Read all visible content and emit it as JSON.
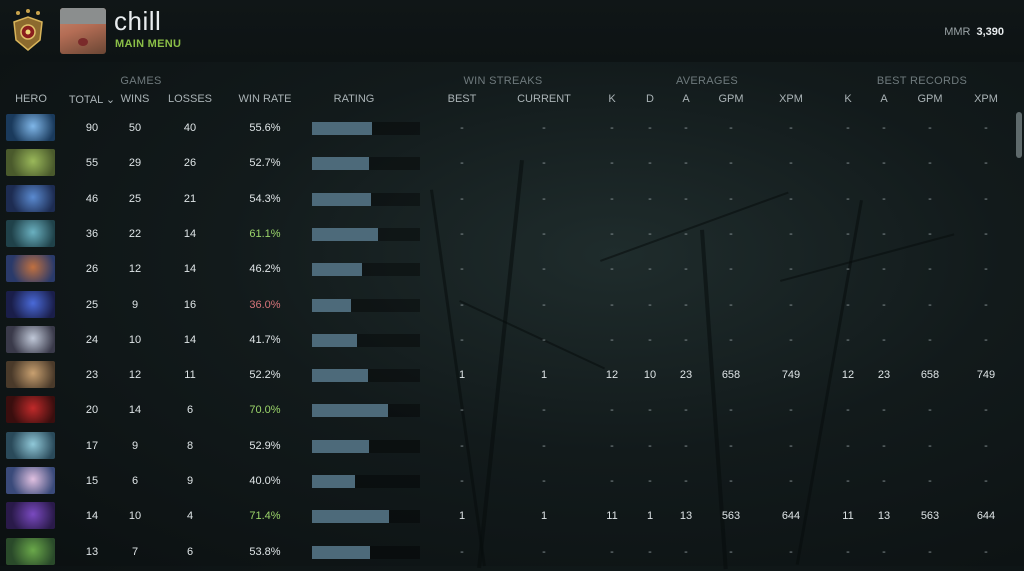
{
  "profile": {
    "name": "chill",
    "subtitle": "MAIN MENU",
    "mmr_label": "MMR",
    "mmr_value": "3,390"
  },
  "groups": {
    "games": "GAMES",
    "win_streaks": "WIN STREAKS",
    "averages": "AVERAGES",
    "best_records": "BEST RECORDS"
  },
  "columns": {
    "hero": "HERO",
    "total": "TOTAL ⌄",
    "wins": "WINS",
    "losses": "LOSSES",
    "win_rate": "WIN RATE",
    "rating": "RATING",
    "best": "BEST",
    "current": "CURRENT",
    "k": "K",
    "d": "D",
    "a": "A",
    "gpm": "GPM",
    "xpm": "XPM",
    "br_k": "K",
    "br_a": "A",
    "br_gpm": "GPM",
    "br_xpm": "XPM"
  },
  "colors": {
    "winrate_high": "#9bd46a",
    "winrate_low": "#d6747a",
    "winrate_normal": "#dfe5e7",
    "rating_bar": "#4d6a7a",
    "mainmenu": "#8bbf47"
  },
  "rows": [
    {
      "hero_icon": "hero-portrait-icon",
      "total": "90",
      "wins": "50",
      "losses": "40",
      "win_rate": "55.6%",
      "rate_level": 0.556,
      "best": "-",
      "current": "-",
      "k": "-",
      "d": "-",
      "a": "-",
      "gpm": "-",
      "xpm": "-",
      "br_k": "-",
      "br_a": "-",
      "br_gpm": "-",
      "br_xpm": "-"
    },
    {
      "hero_icon": "hero-portrait-icon",
      "total": "55",
      "wins": "29",
      "losses": "26",
      "win_rate": "52.7%",
      "rate_level": 0.527,
      "best": "-",
      "current": "-",
      "k": "-",
      "d": "-",
      "a": "-",
      "gpm": "-",
      "xpm": "-",
      "br_k": "-",
      "br_a": "-",
      "br_gpm": "-",
      "br_xpm": "-"
    },
    {
      "hero_icon": "hero-portrait-icon",
      "total": "46",
      "wins": "25",
      "losses": "21",
      "win_rate": "54.3%",
      "rate_level": 0.543,
      "best": "-",
      "current": "-",
      "k": "-",
      "d": "-",
      "a": "-",
      "gpm": "-",
      "xpm": "-",
      "br_k": "-",
      "br_a": "-",
      "br_gpm": "-",
      "br_xpm": "-"
    },
    {
      "hero_icon": "hero-portrait-icon",
      "total": "36",
      "wins": "22",
      "losses": "14",
      "win_rate": "61.1%",
      "rate_level": 0.611,
      "best": "-",
      "current": "-",
      "k": "-",
      "d": "-",
      "a": "-",
      "gpm": "-",
      "xpm": "-",
      "br_k": "-",
      "br_a": "-",
      "br_gpm": "-",
      "br_xpm": "-"
    },
    {
      "hero_icon": "hero-portrait-icon",
      "total": "26",
      "wins": "12",
      "losses": "14",
      "win_rate": "46.2%",
      "rate_level": 0.462,
      "best": "-",
      "current": "-",
      "k": "-",
      "d": "-",
      "a": "-",
      "gpm": "-",
      "xpm": "-",
      "br_k": "-",
      "br_a": "-",
      "br_gpm": "-",
      "br_xpm": "-"
    },
    {
      "hero_icon": "hero-portrait-icon",
      "total": "25",
      "wins": "9",
      "losses": "16",
      "win_rate": "36.0%",
      "rate_level": 0.36,
      "best": "-",
      "current": "-",
      "k": "-",
      "d": "-",
      "a": "-",
      "gpm": "-",
      "xpm": "-",
      "br_k": "-",
      "br_a": "-",
      "br_gpm": "-",
      "br_xpm": "-"
    },
    {
      "hero_icon": "hero-portrait-icon",
      "total": "24",
      "wins": "10",
      "losses": "14",
      "win_rate": "41.7%",
      "rate_level": 0.417,
      "best": "-",
      "current": "-",
      "k": "-",
      "d": "-",
      "a": "-",
      "gpm": "-",
      "xpm": "-",
      "br_k": "-",
      "br_a": "-",
      "br_gpm": "-",
      "br_xpm": "-"
    },
    {
      "hero_icon": "hero-portrait-icon",
      "total": "23",
      "wins": "12",
      "losses": "11",
      "win_rate": "52.2%",
      "rate_level": 0.522,
      "best": "1",
      "current": "1",
      "k": "12",
      "d": "10",
      "a": "23",
      "gpm": "658",
      "xpm": "749",
      "br_k": "12",
      "br_a": "23",
      "br_gpm": "658",
      "br_xpm": "749"
    },
    {
      "hero_icon": "hero-portrait-icon",
      "total": "20",
      "wins": "14",
      "losses": "6",
      "win_rate": "70.0%",
      "rate_level": 0.7,
      "best": "-",
      "current": "-",
      "k": "-",
      "d": "-",
      "a": "-",
      "gpm": "-",
      "xpm": "-",
      "br_k": "-",
      "br_a": "-",
      "br_gpm": "-",
      "br_xpm": "-"
    },
    {
      "hero_icon": "hero-portrait-icon",
      "total": "17",
      "wins": "9",
      "losses": "8",
      "win_rate": "52.9%",
      "rate_level": 0.529,
      "best": "-",
      "current": "-",
      "k": "-",
      "d": "-",
      "a": "-",
      "gpm": "-",
      "xpm": "-",
      "br_k": "-",
      "br_a": "-",
      "br_gpm": "-",
      "br_xpm": "-"
    },
    {
      "hero_icon": "hero-portrait-icon",
      "total": "15",
      "wins": "6",
      "losses": "9",
      "win_rate": "40.0%",
      "rate_level": 0.4,
      "best": "-",
      "current": "-",
      "k": "-",
      "d": "-",
      "a": "-",
      "gpm": "-",
      "xpm": "-",
      "br_k": "-",
      "br_a": "-",
      "br_gpm": "-",
      "br_xpm": "-"
    },
    {
      "hero_icon": "hero-portrait-icon",
      "total": "14",
      "wins": "10",
      "losses": "4",
      "win_rate": "71.4%",
      "rate_level": 0.714,
      "best": "1",
      "current": "1",
      "k": "11",
      "d": "1",
      "a": "13",
      "gpm": "563",
      "xpm": "644",
      "br_k": "11",
      "br_a": "13",
      "br_gpm": "563",
      "br_xpm": "644"
    },
    {
      "hero_icon": "hero-portrait-icon",
      "total": "13",
      "wins": "7",
      "losses": "6",
      "win_rate": "53.8%",
      "rate_level": 0.538,
      "best": "-",
      "current": "-",
      "k": "-",
      "d": "-",
      "a": "-",
      "gpm": "-",
      "xpm": "-",
      "br_k": "-",
      "br_a": "-",
      "br_gpm": "-",
      "br_xpm": "-"
    }
  ]
}
